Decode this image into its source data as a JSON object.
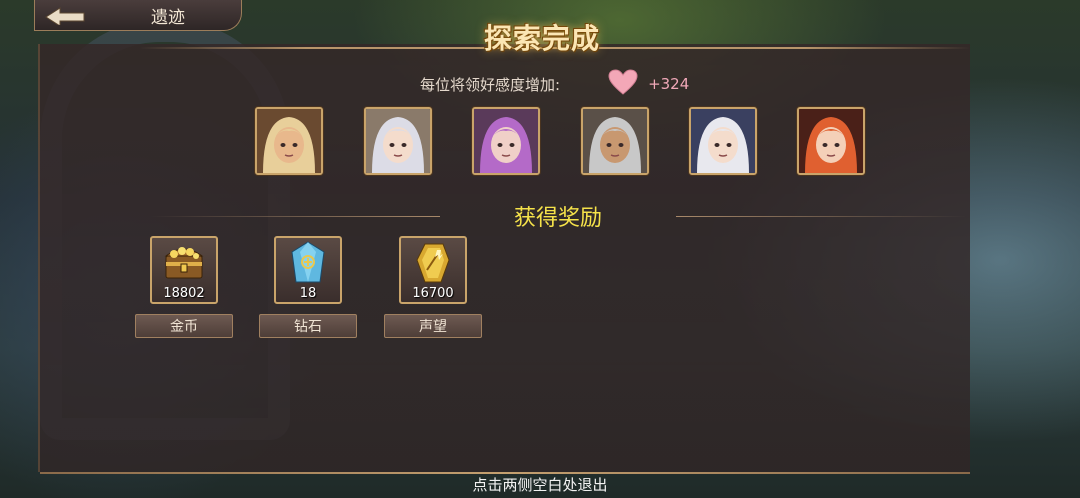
{
  "header": {
    "back_title": "遗迹",
    "banner_title": "探索完成"
  },
  "affinity": {
    "label": "每位将领好感度增加:",
    "value": "+324",
    "icon": "heart-icon"
  },
  "portraits": [
    {
      "name": "portrait-hero-1",
      "hair": "#e8cf9a",
      "skin": "#e8b88c",
      "bg": "#6a4a30"
    },
    {
      "name": "portrait-hero-2",
      "hair": "#dcdce6",
      "skin": "#f4dccc",
      "bg": "#8a7a6a"
    },
    {
      "name": "portrait-hero-3",
      "hair": "#b46ac8",
      "skin": "#f0d0c8",
      "bg": "#5a3a5a"
    },
    {
      "name": "portrait-hero-4",
      "hair": "#c8c8c8",
      "skin": "#c89870",
      "bg": "#5a5048"
    },
    {
      "name": "portrait-hero-5",
      "hair": "#e8e8ee",
      "skin": "#f4dccc",
      "bg": "#3a4060"
    },
    {
      "name": "portrait-hero-6",
      "hair": "#e06030",
      "skin": "#f4d0b8",
      "bg": "#4a2018"
    }
  ],
  "rewards_title": "获得奖励",
  "rewards": [
    {
      "icon": "treasure-chest-icon",
      "count": "18802",
      "label": "金币"
    },
    {
      "icon": "diamond-crystal-icon",
      "count": "18",
      "label": "钻石"
    },
    {
      "icon": "prestige-medal-icon",
      "count": "16700",
      "label": "声望"
    }
  ],
  "footer_hint": "点击两侧空白处退出",
  "colors": {
    "accent_gold": "#c9a46a",
    "reward_title": "#f5e24a",
    "affinity_value": "#f0a8b8"
  }
}
